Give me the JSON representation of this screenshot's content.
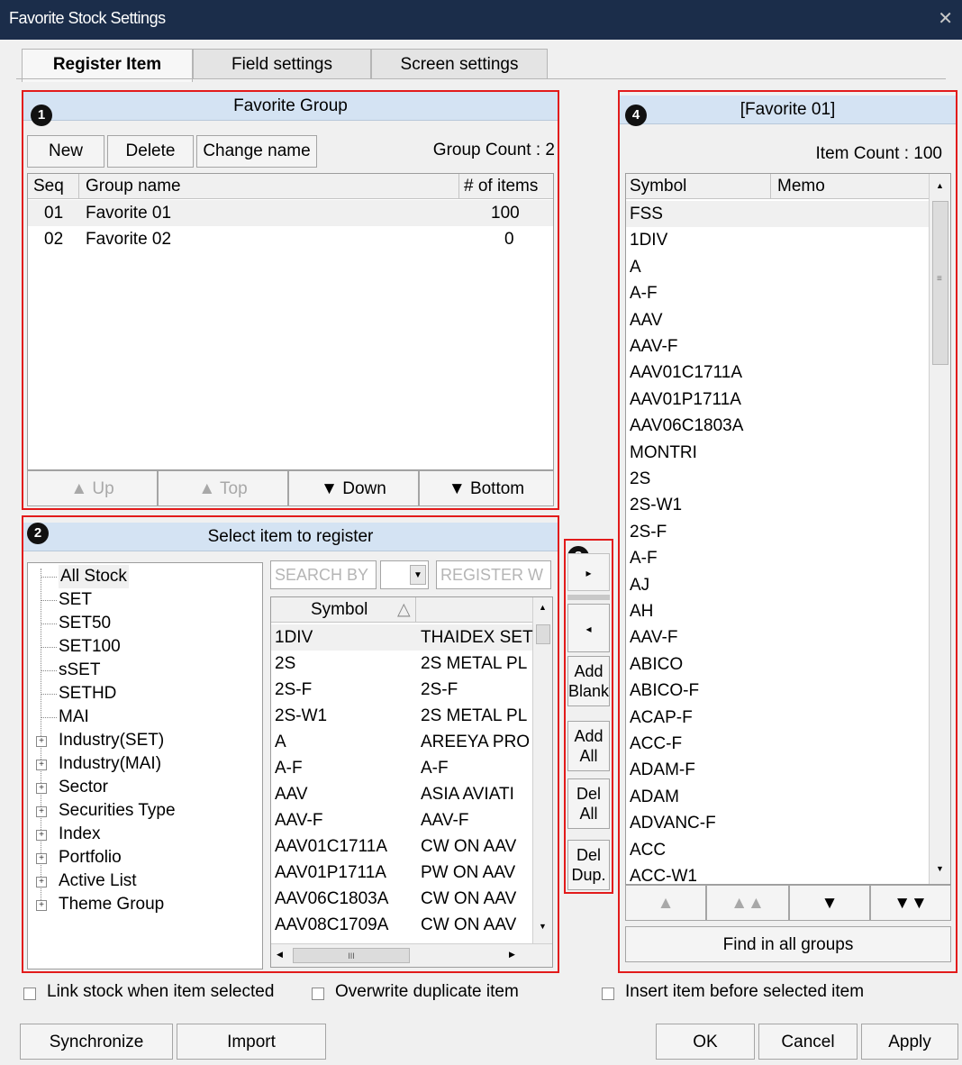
{
  "window": {
    "title": "Favorite Stock Settings",
    "close_glyph": "✕"
  },
  "tabs": [
    "Register Item",
    "Field settings",
    "Screen settings"
  ],
  "sections": {
    "favorite_group": {
      "badge": "1",
      "title": "Favorite Group",
      "buttons": {
        "new": "New",
        "delete": "Delete",
        "change_name": "Change name"
      },
      "group_count": "Group Count : 2",
      "columns": [
        "Seq",
        "Group name",
        "# of items"
      ],
      "rows": [
        {
          "seq": "01",
          "name": "Favorite 01",
          "count": "100"
        },
        {
          "seq": "02",
          "name": "Favorite 02",
          "count": "0"
        }
      ],
      "move_buttons": {
        "up": "▲ Up",
        "top": "▲ Top",
        "down": "▼ Down",
        "bottom": "▼ Bottom"
      }
    },
    "select_item": {
      "badge": "2",
      "title": "Select item to register",
      "tree": [
        "All Stock",
        "SET",
        "SET50",
        "SET100",
        "sSET",
        "SETHD",
        "MAI",
        "Industry(SET)",
        "Industry(MAI)",
        "Sector",
        "Securities Type",
        "Index",
        "Portfolio",
        "Active List",
        "Theme Group"
      ],
      "search_placeholder": "SEARCH BY",
      "register_placeholder": "REGISTER W",
      "columns": [
        "Symbol",
        "△"
      ],
      "rows": [
        {
          "symbol": "1DIV",
          "name": "THAIDEX SET"
        },
        {
          "symbol": "2S",
          "name": "2S METAL PL"
        },
        {
          "symbol": "2S-F",
          "name": "2S-F"
        },
        {
          "symbol": "2S-W1",
          "name": "2S METAL PL"
        },
        {
          "symbol": "A",
          "name": "AREEYA PRO"
        },
        {
          "symbol": "A-F",
          "name": "A-F"
        },
        {
          "symbol": "AAV",
          "name": "ASIA AVIATI"
        },
        {
          "symbol": "AAV-F",
          "name": "AAV-F"
        },
        {
          "symbol": "AAV01C1711A",
          "name": "CW ON AAV"
        },
        {
          "symbol": "AAV01P1711A",
          "name": "PW ON AAV"
        },
        {
          "symbol": "AAV06C1803A",
          "name": "CW ON AAV"
        },
        {
          "symbol": "AAV08C1709A",
          "name": "CW ON AAV"
        }
      ],
      "hscroll_grip": "III"
    },
    "actions": {
      "badge": "3",
      "arrow_right": "▸",
      "arrow_left": "◂",
      "add_blank": [
        "Add",
        "Blank"
      ],
      "add_all": [
        "Add",
        "All"
      ],
      "del_all": [
        "Del",
        "All"
      ],
      "del_dup": [
        "Del",
        "Dup."
      ]
    },
    "favorite_items": {
      "badge": "4",
      "title": "[Favorite 01]",
      "item_count": "Item Count : 100",
      "columns": [
        "Symbol",
        "Memo"
      ],
      "rows": [
        "FSS",
        "1DIV",
        "A",
        "A-F",
        "AAV",
        "AAV-F",
        "AAV01C1711A",
        "AAV01P1711A",
        "AAV06C1803A",
        "MONTRI",
        "2S",
        "2S-W1",
        "2S-F",
        "A-F",
        "AJ",
        "AH",
        "AAV-F",
        "ABICO",
        "ABICO-F",
        "ACAP-F",
        "ACC-F",
        "ADAM-F",
        "ADAM",
        "ADVANC-F",
        "ACC",
        "ACC-W1"
      ],
      "move_buttons": [
        "▲",
        "▲▲",
        "▼",
        "▼▼"
      ],
      "find_all": "Find in all groups"
    }
  },
  "options": {
    "link_stock": "Link stock when item selected",
    "overwrite_dup": "Overwrite duplicate item",
    "insert_before": "Insert item before selected item"
  },
  "footer": {
    "synchronize": "Synchronize",
    "import": "Import",
    "ok": "OK",
    "cancel": "Cancel",
    "apply": "Apply"
  },
  "colors": {
    "highlight_border": "#e21b1b",
    "section_header": "#d4e3f3",
    "titlebar": "#1b2d4a"
  }
}
